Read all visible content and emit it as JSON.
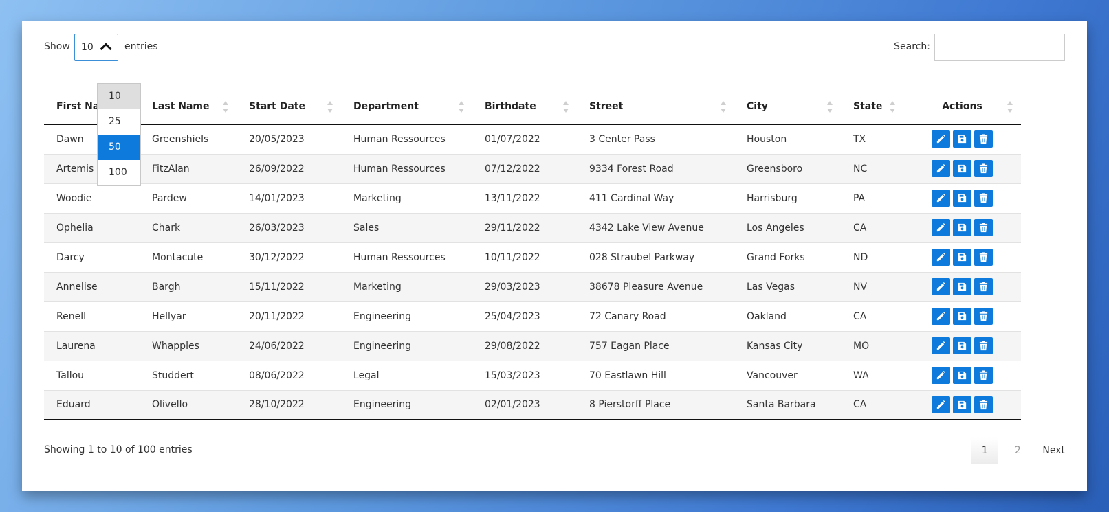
{
  "controls": {
    "show_label": "Show",
    "selected_length": "10",
    "entries_label": "entries",
    "search_label": "Search:",
    "search_value": ""
  },
  "dropdown": {
    "options": [
      "10",
      "25",
      "50",
      "100"
    ],
    "hovered": "10",
    "highlighted": "50"
  },
  "table": {
    "headers": [
      "First Name",
      "Last Name",
      "Start Date",
      "Department",
      "Birthdate",
      "Street",
      "City",
      "State",
      "Actions"
    ],
    "rows": [
      [
        "Dawn",
        "Greenshiels",
        "20/05/2023",
        "Human Ressources",
        "01/07/2022",
        "3 Center Pass",
        "Houston",
        "TX"
      ],
      [
        "Artemis",
        "FitzAlan",
        "26/09/2022",
        "Human Ressources",
        "07/12/2022",
        "9334 Forest Road",
        "Greensboro",
        "NC"
      ],
      [
        "Woodie",
        "Pardew",
        "14/01/2023",
        "Marketing",
        "13/11/2022",
        "411 Cardinal Way",
        "Harrisburg",
        "PA"
      ],
      [
        "Ophelia",
        "Chark",
        "26/03/2023",
        "Sales",
        "29/11/2022",
        "4342 Lake View Avenue",
        "Los Angeles",
        "CA"
      ],
      [
        "Darcy",
        "Montacute",
        "30/12/2022",
        "Human Ressources",
        "10/11/2022",
        "028 Straubel Parkway",
        "Grand Forks",
        "ND"
      ],
      [
        "Annelise",
        "Bargh",
        "15/11/2022",
        "Marketing",
        "29/03/2023",
        "38678 Pleasure Avenue",
        "Las Vegas",
        "NV"
      ],
      [
        "Renell",
        "Hellyar",
        "20/11/2022",
        "Engineering",
        "25/04/2023",
        "72 Canary Road",
        "Oakland",
        "CA"
      ],
      [
        "Laurena",
        "Whapples",
        "24/06/2022",
        "Engineering",
        "29/08/2022",
        "757 Eagan Place",
        "Kansas City",
        "MO"
      ],
      [
        "Tallou",
        "Studdert",
        "08/06/2022",
        "Legal",
        "15/03/2023",
        "70 Eastlawn Hill",
        "Vancouver",
        "WA"
      ],
      [
        "Eduard",
        "Olivello",
        "28/10/2022",
        "Engineering",
        "02/01/2023",
        "8 Pierstorff Place",
        "Santa Barbara",
        "CA"
      ]
    ],
    "action_icons": [
      "pencil-icon",
      "save-icon",
      "trash-icon"
    ]
  },
  "footer": {
    "info": "Showing 1 to 10 of 100 entries",
    "pages": [
      "1",
      "2"
    ],
    "current_page": "1",
    "next_label": "Next"
  },
  "colors": {
    "accent": "#0e7bdc",
    "background_gradient": [
      "#8ec0f2",
      "#2a5fb8"
    ]
  }
}
